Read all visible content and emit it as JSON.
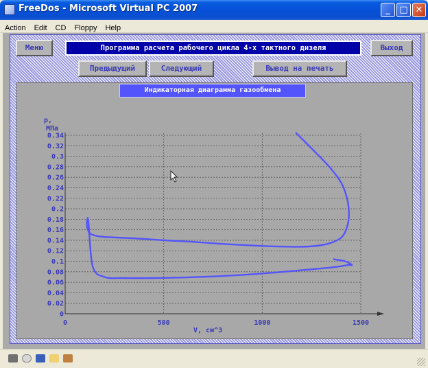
{
  "window": {
    "title": "FreeDos - Microsoft Virtual PC 2007",
    "minimize": "_",
    "maximize": "□",
    "close": "✕"
  },
  "menu": [
    "Action",
    "Edit",
    "CD",
    "Floppy",
    "Help"
  ],
  "app": {
    "menu_button": "Меню",
    "header": "Программа расчета рабочего цикла 4-х тактного дизеля",
    "exit_button": "Выход",
    "prev_button": "Предыдущий",
    "next_button": "Следующий",
    "print_button": "Вывод на печать"
  },
  "chart_data": {
    "type": "line",
    "title": "Индикаторная диаграмма газообмена",
    "ylabel_top": "р,",
    "ylabel_unit": "МПа",
    "xlabel": "V, см^3",
    "xlim": [
      0,
      1500
    ],
    "ylim": [
      0,
      0.34
    ],
    "x_ticks": [
      "0",
      "500",
      "1000",
      "1500"
    ],
    "x_tick_values": [
      0,
      500,
      1000,
      1500
    ],
    "y_ticks": [
      "0",
      "0.02",
      "0.04",
      "0.06",
      "0.08",
      "0.1",
      "0.12",
      "0.14",
      "0.16",
      "0.18",
      "0.2",
      "0.22",
      "0.24",
      "0.26",
      "0.28",
      "0.3",
      "0.32",
      "0.34"
    ],
    "y_tick_values": [
      0,
      0.02,
      0.04,
      0.06,
      0.08,
      0.1,
      0.12,
      0.14,
      0.16,
      0.18,
      0.2,
      0.22,
      0.24,
      0.26,
      0.28,
      0.3,
      0.32,
      0.34
    ],
    "grid": true,
    "line_color": "#5454fc",
    "series": [
      {
        "x": [
          1170,
          1250,
          1340,
          1400,
          1430,
          1440,
          1430,
          1400,
          1330,
          1230,
          1100,
          950,
          800,
          650,
          500,
          380,
          270,
          180,
          130,
          115,
          110,
          112,
          118,
          140,
          200,
          300,
          450,
          600,
          750,
          900,
          1050,
          1200,
          1320,
          1390,
          1435,
          1455,
          1420,
          1360
        ],
        "y": [
          0.345,
          0.315,
          0.28,
          0.25,
          0.22,
          0.19,
          0.165,
          0.145,
          0.133,
          0.128,
          0.128,
          0.13,
          0.133,
          0.137,
          0.14,
          0.143,
          0.145,
          0.147,
          0.152,
          0.16,
          0.17,
          0.178,
          0.175,
          0.09,
          0.07,
          0.068,
          0.068,
          0.069,
          0.071,
          0.074,
          0.078,
          0.083,
          0.087,
          0.09,
          0.093,
          0.093,
          0.1,
          0.104
        ]
      }
    ]
  },
  "status_icons": [
    "hdd-icon",
    "cd-icon",
    "floppy-icon",
    "folder-icon",
    "network-icon"
  ]
}
